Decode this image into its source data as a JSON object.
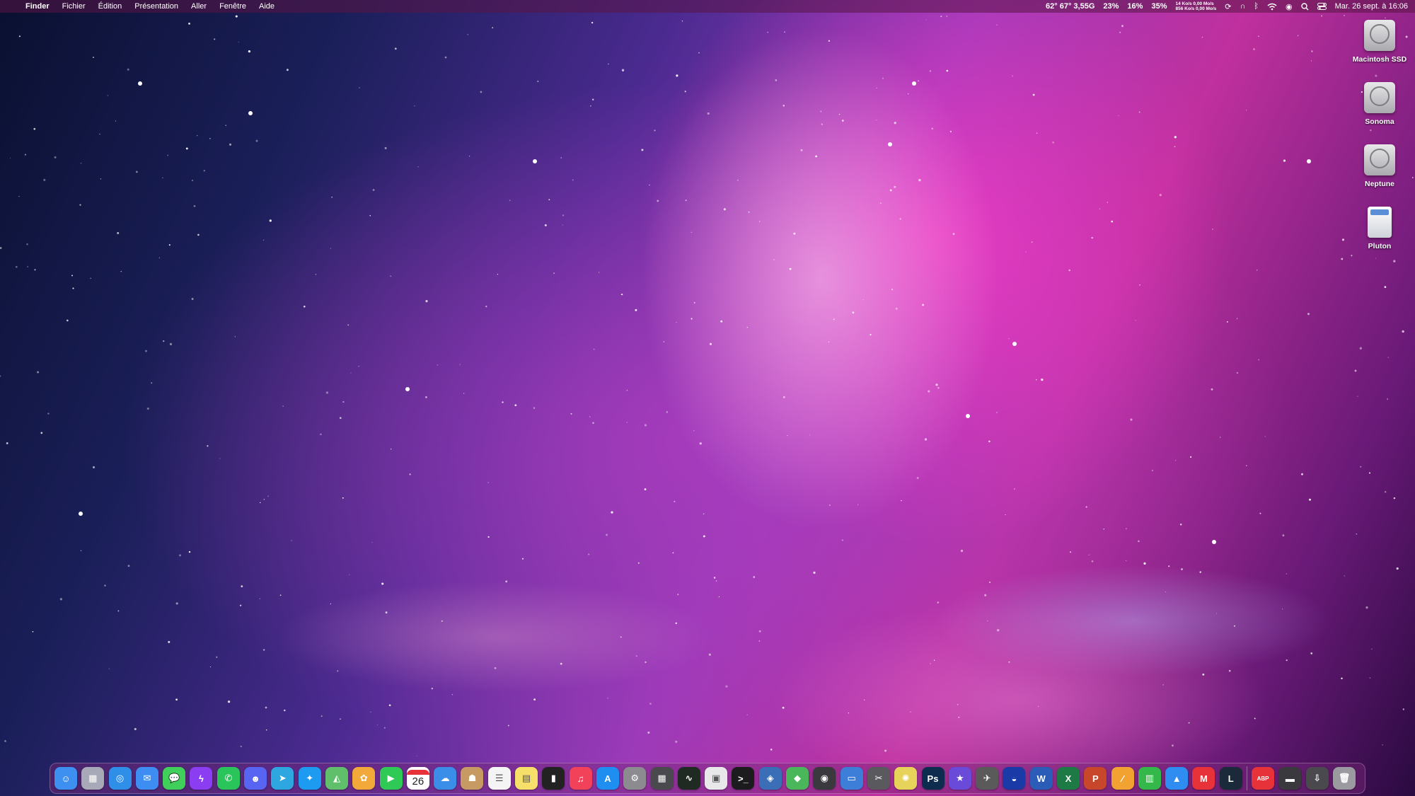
{
  "menubar": {
    "app_name": "Finder",
    "menus": [
      "Fichier",
      "Édition",
      "Présentation",
      "Aller",
      "Fenêtre",
      "Aide"
    ],
    "stats": {
      "temp": "62° 67° 3,55G",
      "cpu": "23%",
      "mem": "16%",
      "disk": "35%",
      "net_line1": "14 Ko/s    0,00 Mo/s",
      "net_line2": "856 Ko/s    0,00 Mo/s"
    },
    "clock": "Mar. 26 sept. à 16:06"
  },
  "desktop_items": [
    {
      "label": "Macintosh SSD",
      "icon": "hard-drive-icon"
    },
    {
      "label": "Sonoma",
      "icon": "hard-drive-icon"
    },
    {
      "label": "Neptune",
      "icon": "hard-drive-icon"
    },
    {
      "label": "Pluton",
      "icon": "sd-card-icon"
    }
  ],
  "dock": {
    "calendar_day": "26",
    "apps": [
      {
        "name": "finder",
        "color": "#3d8ff0",
        "glyph": "☺"
      },
      {
        "name": "launchpad",
        "color": "#a7a9b8",
        "glyph": "▦"
      },
      {
        "name": "safari",
        "color": "#2f8fe8",
        "glyph": "◎"
      },
      {
        "name": "mail",
        "color": "#3d8df2",
        "glyph": "✉"
      },
      {
        "name": "messages",
        "color": "#3fcf5a",
        "glyph": "💬"
      },
      {
        "name": "messenger",
        "color": "#8b3df2",
        "glyph": "ϟ"
      },
      {
        "name": "whatsapp",
        "color": "#29c45a",
        "glyph": "✆"
      },
      {
        "name": "discord",
        "color": "#5865f2",
        "glyph": "☻"
      },
      {
        "name": "telegram",
        "color": "#2ea6e0",
        "glyph": "➤"
      },
      {
        "name": "twitter",
        "color": "#1d9bf0",
        "glyph": "✦"
      },
      {
        "name": "maps",
        "color": "#5fbf6a",
        "glyph": "◭"
      },
      {
        "name": "photos",
        "color": "#f2a93a",
        "glyph": "✿"
      },
      {
        "name": "facetime",
        "color": "#2fc955",
        "glyph": "▶"
      },
      {
        "name": "calendar",
        "color": "#ffffff",
        "glyph": ""
      },
      {
        "name": "weather",
        "color": "#3a8ee8",
        "glyph": "☁"
      },
      {
        "name": "contacts",
        "color": "#c69a62",
        "glyph": "☗"
      },
      {
        "name": "reminders",
        "color": "#f4f4f4",
        "glyph": "☰"
      },
      {
        "name": "notes",
        "color": "#f7e06a",
        "glyph": "▤"
      },
      {
        "name": "istat-menus",
        "color": "#222222",
        "glyph": "▮"
      },
      {
        "name": "music",
        "color": "#f2425a",
        "glyph": "♫"
      },
      {
        "name": "app-store",
        "color": "#1e8ef0",
        "glyph": "A"
      },
      {
        "name": "system-settings",
        "color": "#8c8c90",
        "glyph": "⚙"
      },
      {
        "name": "calculator",
        "color": "#4a4a4e",
        "glyph": "▦"
      },
      {
        "name": "activity-monitor",
        "color": "#1f2a22",
        "glyph": "∿"
      },
      {
        "name": "preview",
        "color": "#e8e8ea",
        "glyph": "▣"
      },
      {
        "name": "terminal",
        "color": "#1c1c1e",
        "glyph": ">_"
      },
      {
        "name": "virtualbox",
        "color": "#3a6fb8",
        "glyph": "◈"
      },
      {
        "name": "3d-builder",
        "color": "#4ab85a",
        "glyph": "◆"
      },
      {
        "name": "screenshot",
        "color": "#3a3a3e",
        "glyph": "◉"
      },
      {
        "name": "preview-blue",
        "color": "#3d7fd8",
        "glyph": "▭"
      },
      {
        "name": "utility-app",
        "color": "#5a5a5e",
        "glyph": "✂"
      },
      {
        "name": "final-cut",
        "color": "#e8d35a",
        "glyph": "✺"
      },
      {
        "name": "photoshop",
        "color": "#0e2c4e",
        "glyph": "Ps"
      },
      {
        "name": "imovie",
        "color": "#6a4ad8",
        "glyph": "★"
      },
      {
        "name": "drone-app",
        "color": "#5a5a5a",
        "glyph": "✈"
      },
      {
        "name": "sunrise-app",
        "color": "#1a3aa8",
        "glyph": "◒"
      },
      {
        "name": "word",
        "color": "#2b5cb8",
        "glyph": "W"
      },
      {
        "name": "excel",
        "color": "#1e7a44",
        "glyph": "X"
      },
      {
        "name": "powerpoint",
        "color": "#c8462a",
        "glyph": "P"
      },
      {
        "name": "pages",
        "color": "#f2a230",
        "glyph": "∕"
      },
      {
        "name": "numbers",
        "color": "#34b84a",
        "glyph": "▥"
      },
      {
        "name": "keynote",
        "color": "#2f8cf0",
        "glyph": "▲"
      },
      {
        "name": "reeder",
        "color": "#e8323a",
        "glyph": "M"
      },
      {
        "name": "league-of-legends",
        "color": "#1a2a3a",
        "glyph": "L"
      },
      {
        "name": "adblock",
        "color": "#e8323a",
        "glyph": "ABP"
      },
      {
        "name": "disk-app",
        "color": "#3a3a3e",
        "glyph": "▬"
      },
      {
        "name": "downloads",
        "color": "#4a4a4e",
        "glyph": "⇩"
      },
      {
        "name": "trash",
        "color": "#9a9aa0",
        "glyph": "🗑"
      }
    ]
  }
}
